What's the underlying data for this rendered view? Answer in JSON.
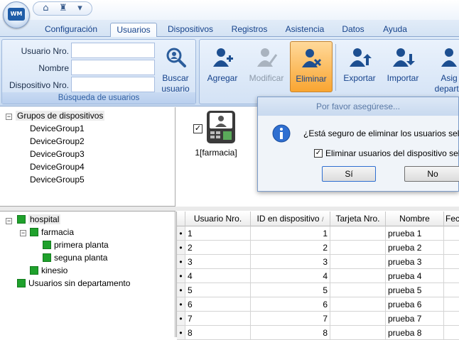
{
  "app": {
    "logo_text": "WM"
  },
  "quick_access": [
    "home-icon",
    "stamp-icon",
    "dropdown-icon"
  ],
  "tabs": [
    {
      "label": "Configuración",
      "active": false
    },
    {
      "label": "Usuarios",
      "active": true
    },
    {
      "label": "Dispositivos",
      "active": false
    },
    {
      "label": "Registros",
      "active": false
    },
    {
      "label": "Asistencia",
      "active": false
    },
    {
      "label": "Datos",
      "active": false
    },
    {
      "label": "Ayuda",
      "active": false
    }
  ],
  "search": {
    "user_no_label": "Usuario Nro.",
    "name_label": "Nombre",
    "device_no_label": "Dispositivo Nro.",
    "user_no_value": "",
    "name_value": "",
    "device_no_value": "",
    "button_label_1": "Buscar",
    "button_label_2": "usuario",
    "group_label": "Búsqueda de usuarios"
  },
  "actions": {
    "add": "Agregar",
    "modify": "Modificar",
    "delete": "Eliminar",
    "export": "Exportar",
    "import": "Importar",
    "assign_1": "Asig",
    "assign_2": "departa"
  },
  "device_groups": {
    "root": "Grupos de dispositivos",
    "items": [
      "DeviceGroup1",
      "DeviceGroup2",
      "DeviceGroup3",
      "DeviceGroup4",
      "DeviceGroup5"
    ]
  },
  "device": {
    "label": "1[farmacia]",
    "checked": true
  },
  "dialog": {
    "title": "Por favor asegúrese...",
    "message": "¿Está seguro de eliminar los usuarios sele",
    "checkbox_label": "Eliminar usuarios del dispositivo sele",
    "checkbox_checked": true,
    "yes": "Sí",
    "no": "No"
  },
  "departments": {
    "root": "hospital",
    "child": "farmacia",
    "grandchildren": [
      "primera planta",
      "seguna planta"
    ],
    "sibling": "kinesio",
    "unassigned": "Usuarios sin departamento"
  },
  "grid": {
    "columns": [
      "Usuario Nro.",
      "ID en dispositivo",
      "Tarjeta Nro.",
      "Nombre",
      "Fech"
    ],
    "sort_indicator": "/",
    "rows": [
      {
        "user_no": "1",
        "device_id": "1",
        "card": "",
        "name": "prueba 1"
      },
      {
        "user_no": "2",
        "device_id": "2",
        "card": "",
        "name": "prueba 2"
      },
      {
        "user_no": "3",
        "device_id": "3",
        "card": "",
        "name": "prueba 3"
      },
      {
        "user_no": "4",
        "device_id": "4",
        "card": "",
        "name": "prueba 4"
      },
      {
        "user_no": "5",
        "device_id": "5",
        "card": "",
        "name": "prueba 5"
      },
      {
        "user_no": "6",
        "device_id": "6",
        "card": "",
        "name": "prueba 6"
      },
      {
        "user_no": "7",
        "device_id": "7",
        "card": "",
        "name": "prueba 7"
      },
      {
        "user_no": "8",
        "device_id": "8",
        "card": "",
        "name": "prueba 8"
      }
    ]
  },
  "colors": {
    "accent": "#15428b",
    "active_button": "#f9a531",
    "dept_node": "#1fa12c",
    "ribbon": "#d3e2f5"
  }
}
